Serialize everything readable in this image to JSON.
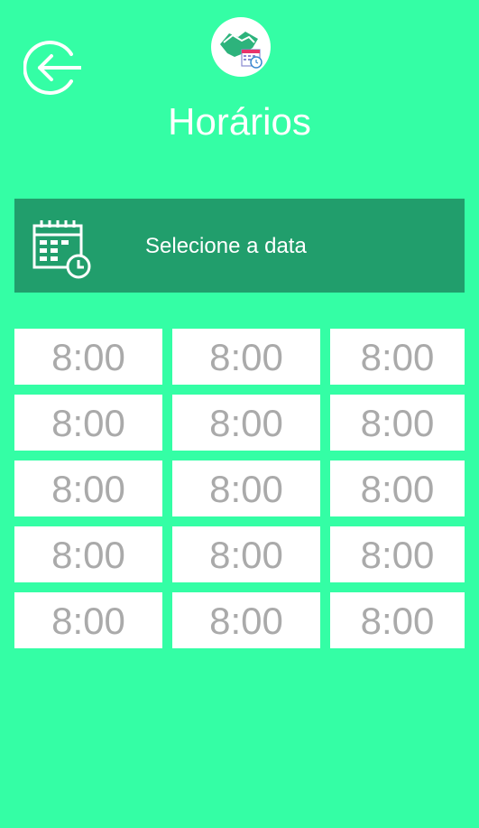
{
  "header": {
    "title": "Horários",
    "back_icon": "back-arrow-circle-icon",
    "logo_icon": "handshake-calendar-icon"
  },
  "date_selector": {
    "label": "Selecione a data",
    "icon": "calendar-clock-icon"
  },
  "time_slots": [
    [
      "8:00",
      "8:00",
      "8:00"
    ],
    [
      "8:00",
      "8:00",
      "8:00"
    ],
    [
      "8:00",
      "8:00",
      "8:00"
    ],
    [
      "8:00",
      "8:00",
      "8:00"
    ],
    [
      "8:00",
      "8:00",
      "8:00"
    ]
  ],
  "colors": {
    "background": "#34fea5",
    "date_bar": "#219e6c",
    "slot_bg": "#ffffff",
    "slot_text": "#aaaaaa"
  }
}
